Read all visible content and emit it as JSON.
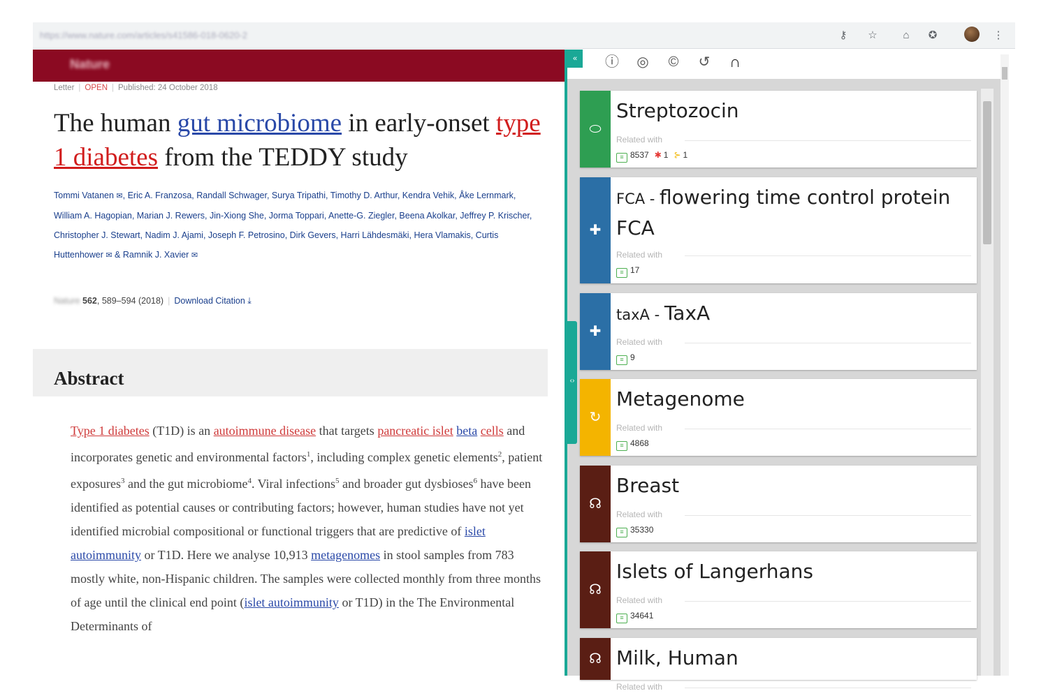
{
  "browser": {
    "url": "https://www.nature.com/articles/s41586-018-0620-2",
    "icons": [
      "key-icon",
      "star-icon",
      "extension-icon",
      "extension-icon-2",
      "menu-icon"
    ]
  },
  "article": {
    "meta": {
      "type": "Letter",
      "access": "OPEN",
      "published": "Published: 24 October 2018"
    },
    "title": {
      "part1": "The human ",
      "link1": "gut microbiome",
      "part2": " in early-onset ",
      "link2": "type 1 diabetes",
      "part3": " from the TEDDY study"
    },
    "authors": {
      "line1": "Tommi Vatanen",
      "line1b": ", Eric A. Franzosa, Randall Schwager, Surya Tripathi, Timothy D. Arthur, Kendra Vehik, Åke Lernmark, William A. Hagopian, Marian J. Rewers, Jin-Xiong She, Jorma Toppari, Anette-G. Ziegler, Beena Akolkar, Jeffrey P. Krischer, Christopher J. Stewart, Nadim J. Ajami, Joseph F. Petrosino, Dirk Gevers, Harri Lähdesmäki, Hera Vlamakis, Curtis Huttenhower",
      "amp": " & Ramnik J. Xavier"
    },
    "citation": {
      "journal": "Nature",
      "volume": "562",
      "pages": ", 589–594 (2018)",
      "download": "Download Citation"
    },
    "abstract_heading": "Abstract",
    "abstract": {
      "t1": "Type 1 diabetes",
      "t2": " (T1D) is an ",
      "t3": "autoimmune disease",
      "t4": " that targets ",
      "t5": "pancreatic islet",
      "t6": " ",
      "t7": "beta",
      "t8": " ",
      "t9": "cells",
      "t10": " and incorporates genetic and environmental factors",
      "s1": "1",
      "t11": ", including complex genetic elements",
      "s2": "2",
      "t12": ", patient exposures",
      "s3": "3",
      "t13": " and the gut microbiome",
      "s4": "4",
      "t14": ". Viral infections",
      "s5": "5",
      "t15": " and broader gut dysbioses",
      "s6": "6",
      "t16": " have been identified as potential causes or contributing factors; however, human studies have not yet identified microbial compositional or functional triggers that are predictive of ",
      "t17": "islet",
      "t18": " ",
      "t19": "autoimmunity",
      "t20": " or T1D. Here we analyse 10,913 ",
      "t21": "metagenomes",
      "t22": " in stool samples from 783 mostly white, non-Hispanic children. The samples were collected monthly from three months of age until the clinical end point (",
      "t23": "islet autoimmunity",
      "t24": " or T1D) in the The Environmental Determinants of"
    }
  },
  "panel": {
    "collapse_label": "«",
    "toolbar": [
      "info-icon",
      "chat-icon",
      "copyright-icon",
      "history-icon",
      "headphones-icon"
    ],
    "related_label": "Related with",
    "cards": [
      {
        "title": "Streptozocin",
        "abbr": "",
        "color": "#2e9e52",
        "icon": "pill-icon",
        "glyph": "⬭",
        "count": "8537",
        "red": "1",
        "yellow": "1"
      },
      {
        "title": "flowering time control protein FCA",
        "abbr": "FCA - ",
        "color": "#2b6fa6",
        "icon": "gene-icon",
        "glyph": "✚",
        "count": "17",
        "red": "",
        "yellow": ""
      },
      {
        "title": "TaxA",
        "abbr": "taxA - ",
        "color": "#2b6fa6",
        "icon": "gene-icon",
        "glyph": "✚",
        "count": "9",
        "red": "",
        "yellow": ""
      },
      {
        "title": "Metagenome",
        "abbr": "",
        "color": "#f4b400",
        "icon": "cycle-icon",
        "glyph": "↻",
        "count": "4868",
        "red": "",
        "yellow": ""
      },
      {
        "title": "Breast",
        "abbr": "",
        "color": "#5a1e14",
        "icon": "anatomy-icon",
        "glyph": "☊",
        "count": "35330",
        "red": "",
        "yellow": ""
      },
      {
        "title": "Islets of Langerhans",
        "abbr": "",
        "color": "#5a1e14",
        "icon": "anatomy-icon",
        "glyph": "☊",
        "count": "34641",
        "red": "",
        "yellow": ""
      },
      {
        "title": "Milk, Human",
        "abbr": "",
        "color": "#5a1e14",
        "icon": "anatomy-icon",
        "glyph": "☊",
        "count": "",
        "red": "",
        "yellow": ""
      }
    ]
  }
}
